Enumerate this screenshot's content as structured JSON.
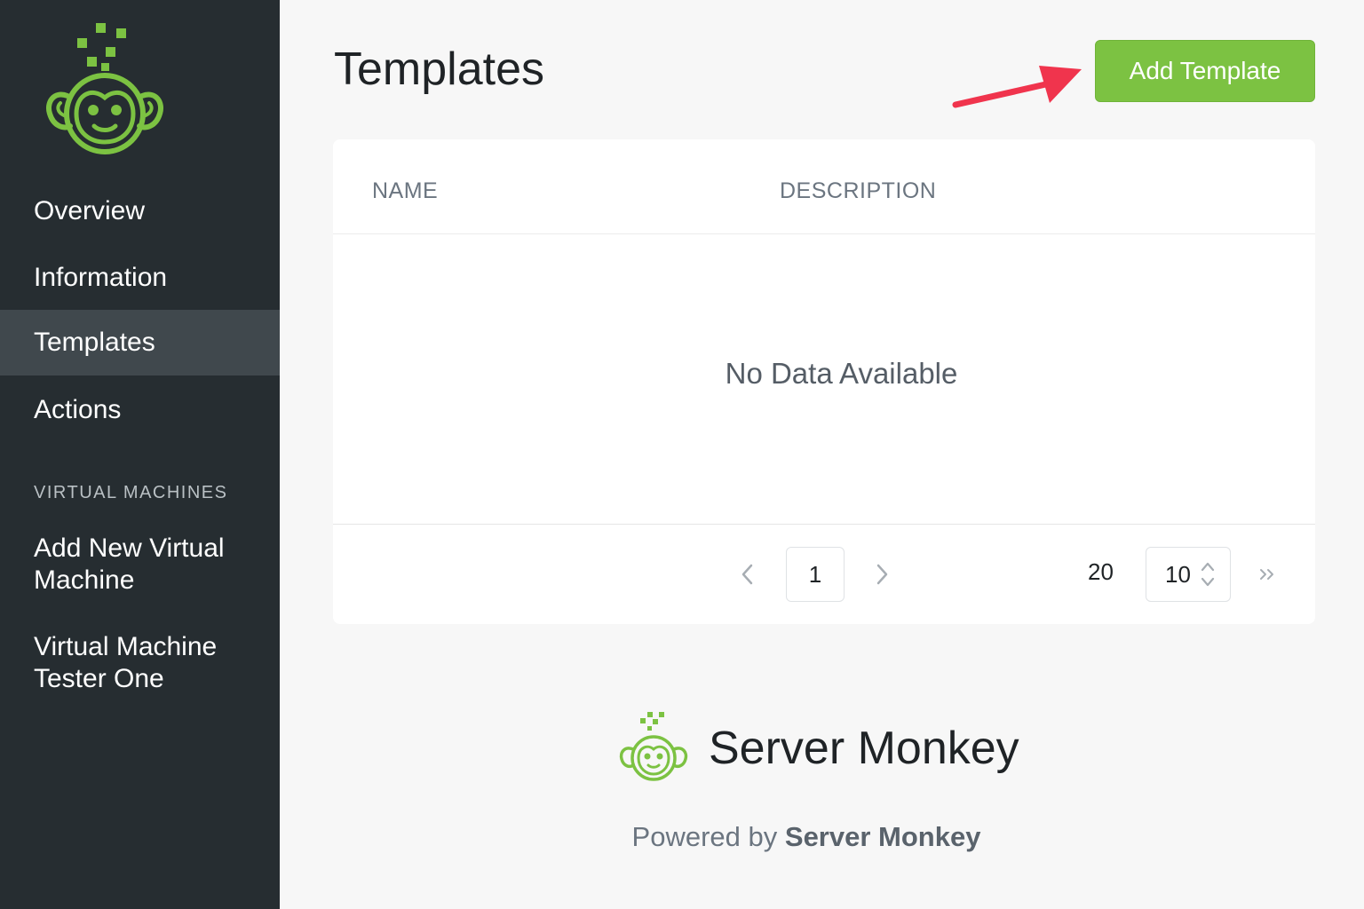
{
  "sidebar": {
    "nav_items": [
      {
        "label": "Overview"
      },
      {
        "label": "Information"
      },
      {
        "label": "Templates"
      },
      {
        "label": "Actions"
      }
    ],
    "section_title": "VIRTUAL MACHINES",
    "vm_items": [
      {
        "line1": "Add New Virtual",
        "line2": "Machine"
      },
      {
        "line1": "Virtual Machine",
        "line2": "Tester One"
      }
    ]
  },
  "main": {
    "title": "Templates",
    "add_button_label": "Add Template",
    "table": {
      "columns": [
        "NAME",
        "DESCRIPTION"
      ],
      "empty_message": "No Data Available"
    },
    "pagination": {
      "current_page": "1",
      "total": "20",
      "page_size": "10"
    }
  },
  "branding": {
    "name": "Server Monkey",
    "powered_prefix": "Powered by",
    "powered_name": "Server Monkey"
  },
  "colors": {
    "sidebar_bg": "#262d31",
    "active_bg": "#40484d",
    "accent": "#7cc242",
    "arrow": "#f0344d"
  }
}
